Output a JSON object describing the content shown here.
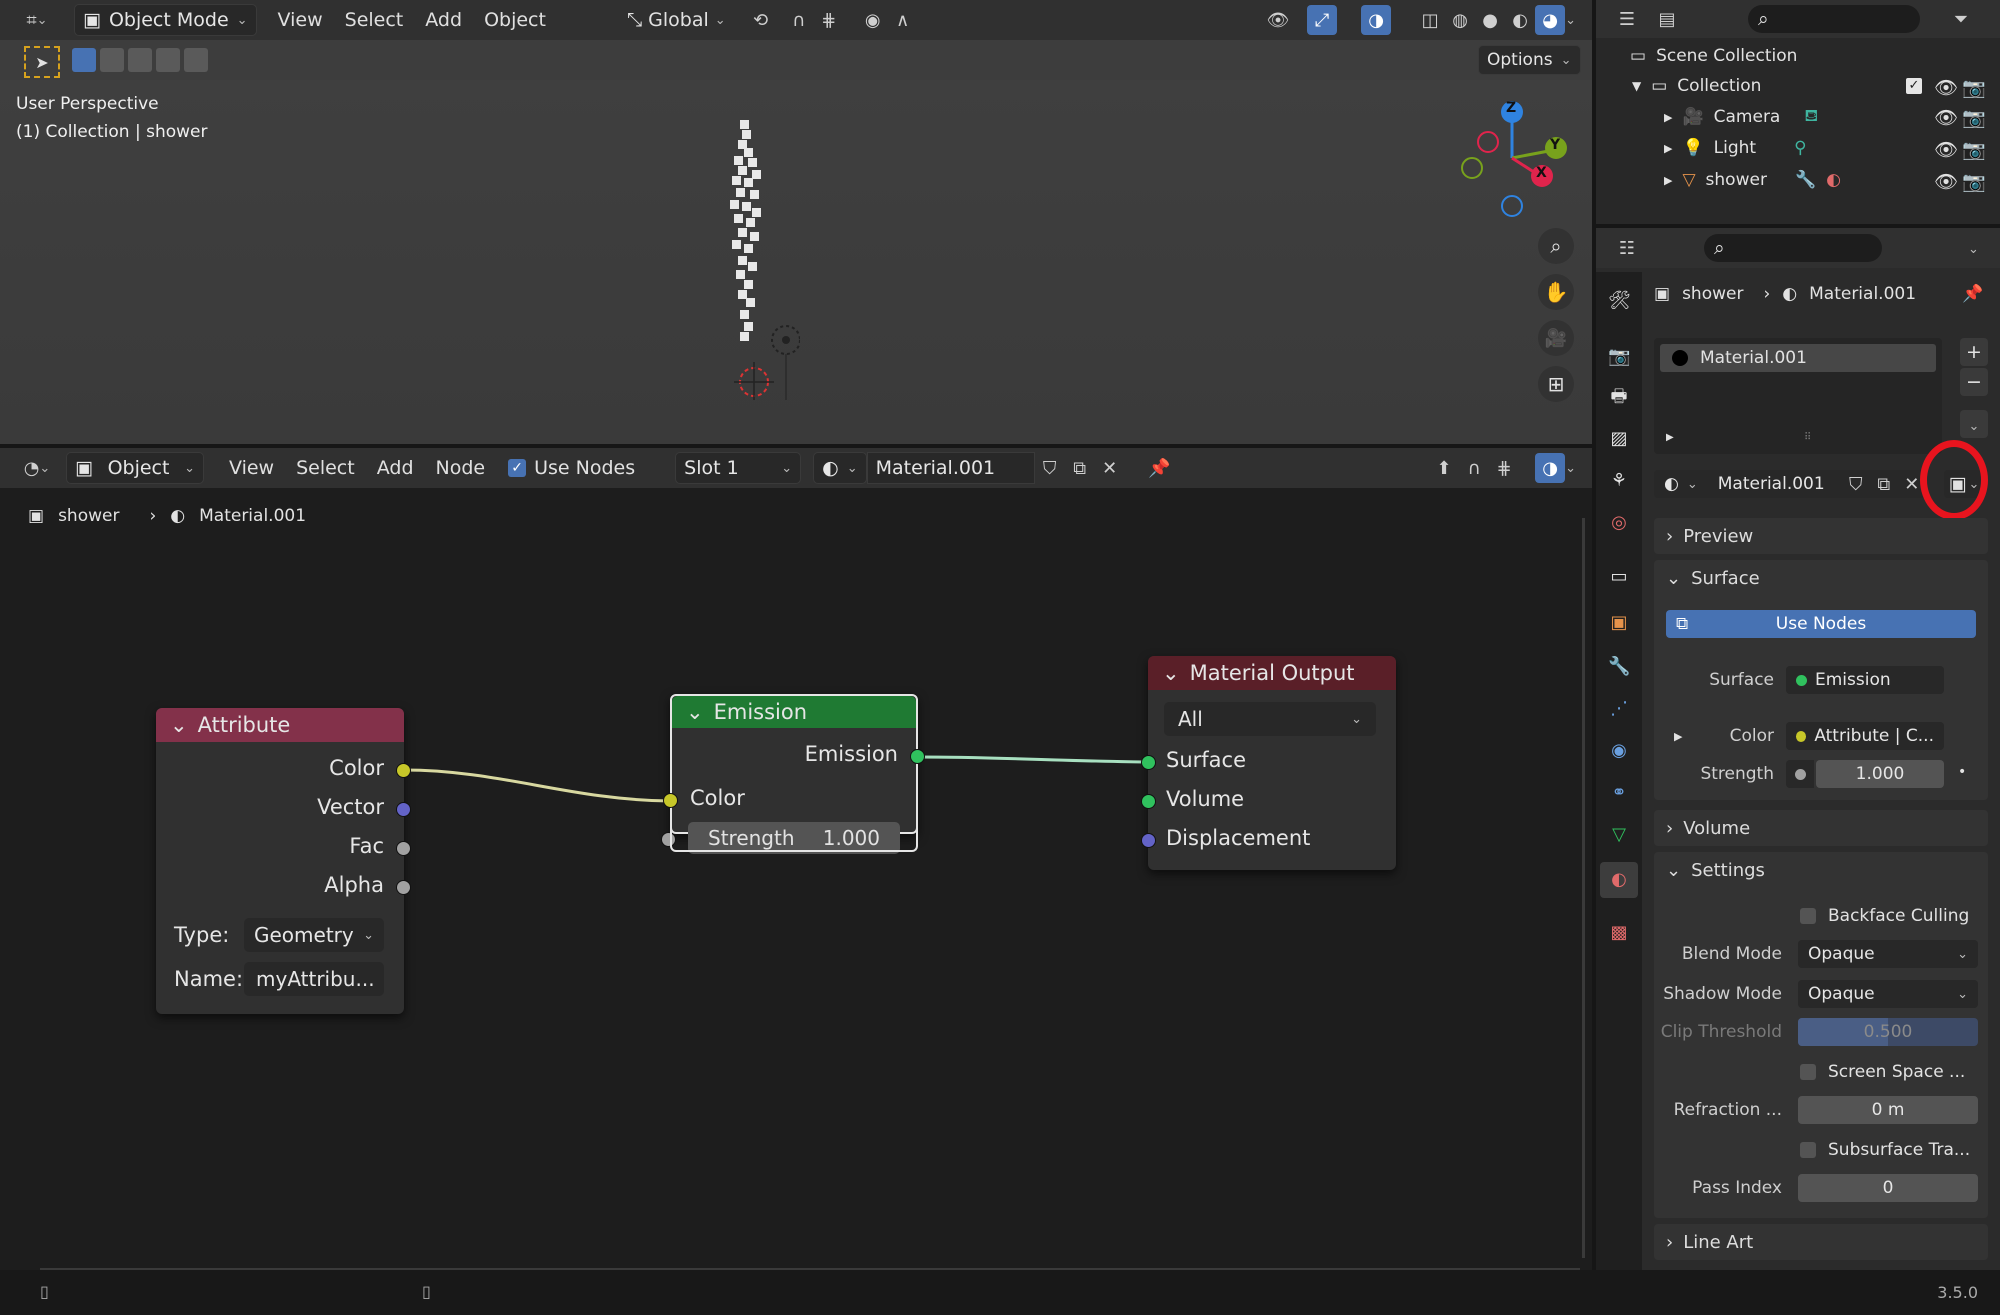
{
  "viewport": {
    "mode_label": "Object Mode",
    "menus": [
      "View",
      "Select",
      "Add",
      "Object"
    ],
    "transform_orientation": "Global",
    "options_label": "Options",
    "overlay_line1": "User Perspective",
    "overlay_line2": "(1) Collection | shower",
    "gizmo": {
      "x": "X",
      "y": "Y",
      "z": "Z"
    }
  },
  "node_editor": {
    "type_label": "Object",
    "menus": [
      "View",
      "Select",
      "Add",
      "Node"
    ],
    "use_nodes_label": "Use Nodes",
    "slot_label": "Slot 1",
    "material_name": "Material.001",
    "breadcrumb": {
      "object": "shower",
      "material": "Material.001"
    },
    "nodes": {
      "attribute": {
        "title": "Attribute",
        "outputs": [
          "Color",
          "Vector",
          "Fac",
          "Alpha"
        ],
        "type_label": "Type:",
        "type_value": "Geometry",
        "name_label": "Name:",
        "name_value": "myAttribu..."
      },
      "emission": {
        "title": "Emission",
        "output": "Emission",
        "input_color": "Color",
        "strength_label": "Strength",
        "strength_value": "1.000"
      },
      "material_output": {
        "title": "Material Output",
        "target": "All",
        "inputs": [
          "Surface",
          "Volume",
          "Displacement"
        ]
      }
    }
  },
  "outliner": {
    "root": "Scene Collection",
    "collection": "Collection",
    "items": [
      {
        "name": "Camera"
      },
      {
        "name": "Light"
      },
      {
        "name": "shower"
      }
    ]
  },
  "properties": {
    "breadcrumb": {
      "object": "shower",
      "material": "Material.001"
    },
    "slot_material": "Material.001",
    "material_name": "Material.001",
    "panels": {
      "preview": "Preview",
      "surface": "Surface",
      "volume": "Volume",
      "settings": "Settings",
      "line_art": "Line Art"
    },
    "use_nodes_button": "Use Nodes",
    "surface_label": "Surface",
    "surface_value": "Emission",
    "color_label": "Color",
    "color_value": "Attribute | C...",
    "strength_label": "Strength",
    "strength_value": "1.000",
    "backface_culling": "Backface Culling",
    "blend_mode_label": "Blend Mode",
    "blend_mode_value": "Opaque",
    "shadow_mode_label": "Shadow Mode",
    "shadow_mode_value": "Opaque",
    "clip_threshold_label": "Clip Threshold",
    "clip_threshold_value": "0.500",
    "screen_space": "Screen Space ...",
    "refraction_label": "Refraction ...",
    "refraction_value": "0 m",
    "subsurface": "Subsurface Tra...",
    "pass_index_label": "Pass Index",
    "pass_index_value": "0"
  },
  "status": {
    "version": "3.5.0"
  },
  "colors": {
    "accent_blue": "#4772b3",
    "attribute_header": "#83314a",
    "emission_header": "#1f7a33",
    "output_header": "#5a1f28",
    "socket_yellow": "#c7c729",
    "socket_purple": "#6363c7",
    "socket_grey": "#a1a1a1",
    "socket_green": "#30c15e",
    "highlight_red": "#e8141e"
  }
}
